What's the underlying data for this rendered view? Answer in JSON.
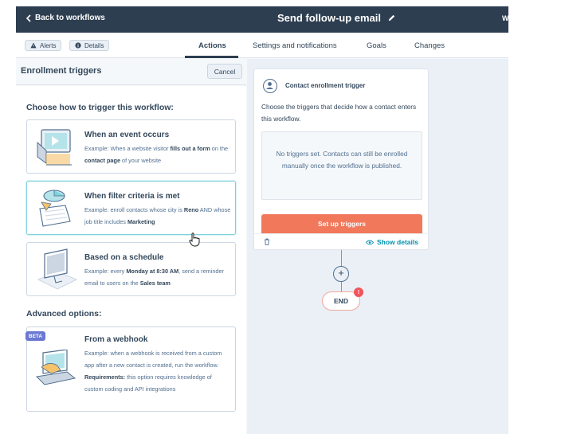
{
  "topbar": {
    "back_label": "Back to workflows",
    "title": "Send follow-up email",
    "right_text": "W"
  },
  "tabbar": {
    "alerts_label": "Alerts",
    "details_label": "Details",
    "tabs": [
      {
        "label": "Actions",
        "active": true
      },
      {
        "label": "Settings and notifications",
        "active": false
      },
      {
        "label": "Goals",
        "active": false
      },
      {
        "label": "Changes",
        "active": false
      }
    ]
  },
  "panel": {
    "title": "Enrollment triggers",
    "cancel_label": "Cancel",
    "choose_heading": "Choose how to trigger this workflow:",
    "advanced_heading": "Advanced options:",
    "options": [
      {
        "title": "When an event occurs",
        "desc_parts": [
          "Example: When a website visitor ",
          "fills out a form",
          " on the ",
          "contact page",
          " of your website"
        ]
      },
      {
        "title": "When filter criteria is met",
        "desc_parts": [
          "Example: enroll contacts whose city is ",
          "Reno",
          " AND whose job title includes ",
          "Marketing",
          ""
        ]
      },
      {
        "title": "Based on a schedule",
        "desc_parts": [
          "Example: every ",
          "Monday at 8:30 AM",
          ", send a reminder email to users on the ",
          "Sales team",
          ""
        ]
      }
    ],
    "webhook": {
      "badge": "BETA",
      "title": "From a webhook",
      "desc": "Example: when a webhook is received from a custom app after a new contact is created, run the workflow.",
      "req_label": "Requirements:",
      "req_text": " this option requires knowledge of custom coding and API integrations"
    }
  },
  "canvas": {
    "trigger_title": "Contact enrollment trigger",
    "trigger_desc": "Choose the triggers that decide how a contact enters this workflow.",
    "empty_text": "No triggers set. Contacts can still be enrolled manually once the workflow is published.",
    "setup_label": "Set up triggers",
    "show_details_label": "Show details",
    "plus_label": "+",
    "end_label": "END",
    "end_badge": "!"
  },
  "colors": {
    "topbar": "#2d3e50",
    "accent_orange": "#f2785b",
    "link_teal": "#0091ae",
    "beta_purple": "#6a78d1",
    "alert_red": "#f2545b"
  }
}
